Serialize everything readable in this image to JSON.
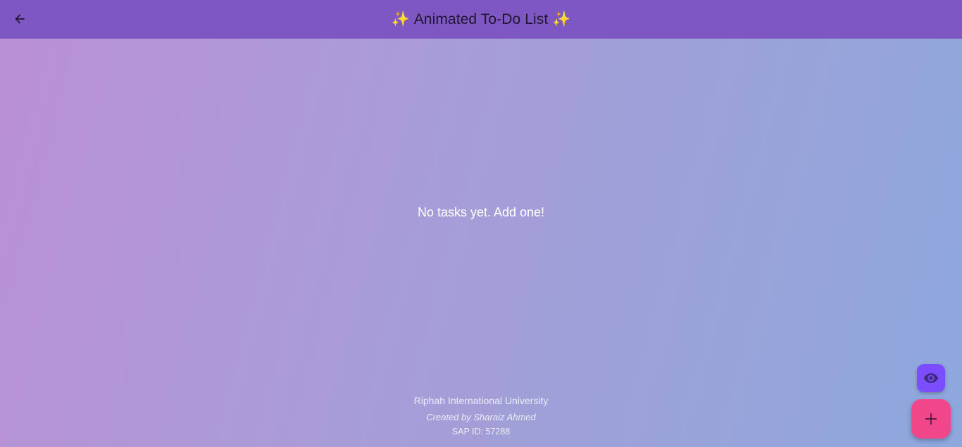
{
  "appbar": {
    "title": "Animated To-Do List",
    "title_prefix_emoji": "✨",
    "title_suffix_emoji": "✨",
    "back_icon": "arrow-back-icon",
    "background": "#7e57c2"
  },
  "main": {
    "empty_message": "No tasks yet. Add one!",
    "gradient_start": "#ba8fd6",
    "gradient_end": "#8da8de"
  },
  "footer": {
    "university": "Riphah International University",
    "author": "Created by Sharaiz Ahmed",
    "sap_id": "SAP ID: 57288"
  },
  "fabs": {
    "view_icon": "eye-icon",
    "view_color": "#7c4dff",
    "add_icon": "plus-icon",
    "add_color": "#f2468a"
  }
}
